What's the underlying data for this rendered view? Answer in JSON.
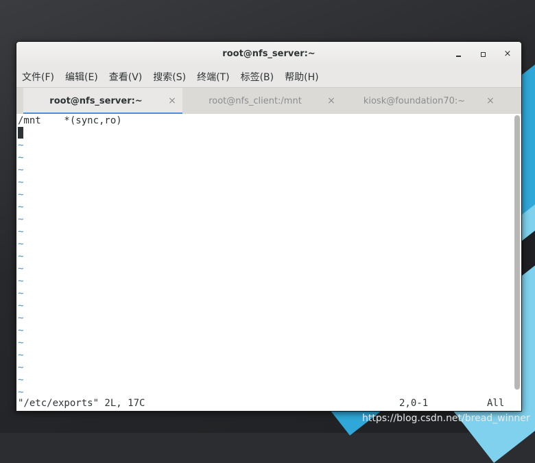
{
  "window": {
    "title": "root@nfs_server:~"
  },
  "menu": [
    "文件(F)",
    "编辑(E)",
    "查看(V)",
    "搜索(S)",
    "终端(T)",
    "标签(B)",
    "帮助(H)"
  ],
  "tabs": [
    {
      "label": "root@nfs_server:~",
      "active": true
    },
    {
      "label": "root@nfs_client:/mnt",
      "active": false
    },
    {
      "label": "kiosk@foundation70:~",
      "active": false
    }
  ],
  "terminal": {
    "lines": [
      "/mnt    *(sync,ro)"
    ],
    "tilde_char": "~",
    "status_file": "\"/etc/exports\" 2L, 17C",
    "status_pos": "2,0-1",
    "status_all": "All"
  },
  "watermark": "https://blog.csdn.net/bread_winner",
  "colors": {
    "accent": "#4a90d9"
  },
  "icons": {
    "close": "×"
  }
}
